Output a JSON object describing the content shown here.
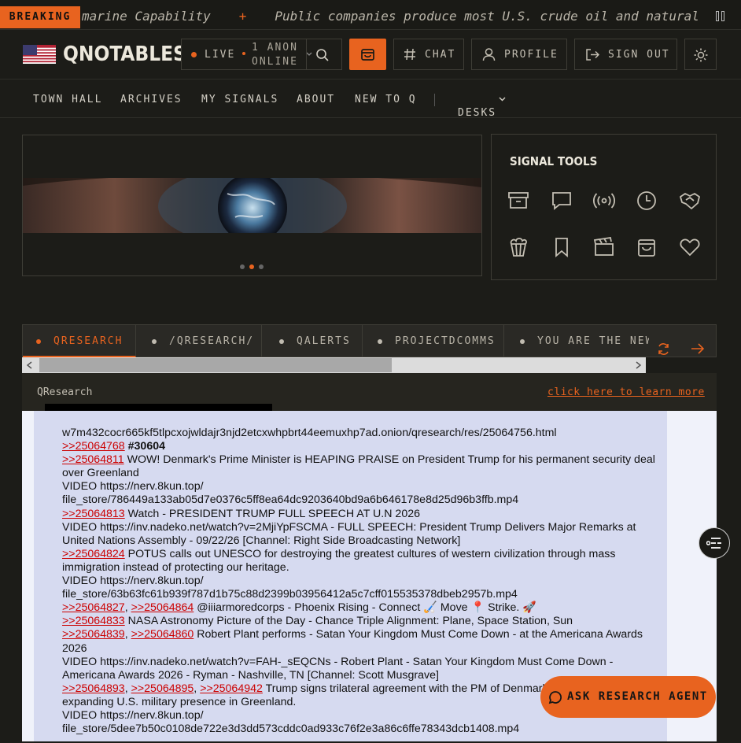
{
  "ticker": {
    "badge": "BREAKING",
    "items": [
      "marine Capability",
      "Public companies produce most U.S. crude oil and natural g"
    ],
    "separator": "+"
  },
  "header": {
    "logo": "QNOTABLES",
    "live_label": "LIVE",
    "online_count": "1 ANON",
    "online_label": "ONLINE",
    "chat_label": "CHAT",
    "profile_label": "PROFILE",
    "signout_label": "SIGN OUT"
  },
  "nav": {
    "items": [
      "TOWN HALL",
      "ARCHIVES",
      "MY SIGNALS",
      "ABOUT",
      "NEW TO Q"
    ],
    "desks_label": "DESKS"
  },
  "tools": {
    "title": "SIGNAL TOOLS",
    "icons": [
      "archive-icon",
      "chat-bubble-icon",
      "broadcast-icon",
      "clock-icon",
      "handshake-icon",
      "popcorn-icon",
      "bookmark-icon",
      "clapperboard-icon",
      "shopping-bag-icon",
      "heart-icon"
    ]
  },
  "tabs": [
    "QRESEARCH",
    "/QRESEARCH/",
    "QALERTS",
    "PROJECTDCOMMS",
    "YOU ARE THE NEW"
  ],
  "frame": {
    "board_name": "QResearch",
    "learn_more": "click here to learn more"
  },
  "post": {
    "url_line": "w7m432cocr665kf5tlpcxojwldajr3njd2etcxwhpbrt44eemuxhp7ad.onion/qresearch/res/25064756.html",
    "l1_ref": ">>25064768",
    "l1_text": "#30604",
    "l2_ref": ">>25064811",
    "l2_text": " WOW! Denmark's Prime Minister is HEAPING PRAISE on President Trump for his permanent security deal over Greenland",
    "l3": "VIDEO https://nerv.8kun.top/",
    "l4": "file_store/786449a133ab05d7e0376c5ff8ea64dc9203640bd9a6b646178e8d25d96b3ffb.mp4",
    "l5_ref": ">>25064813",
    "l5_text": " Watch - PRESIDENT TRUMP FULL SPEECH AT U.N 2026",
    "l6": "VIDEO https://inv.nadeko.net/watch?v=2MjiYpFSCMA - FULL SPEECH: President Trump Delivers Major Remarks at United Nations Assembly - 09/22/26 [Channel: Right Side Broadcasting Network]",
    "l7_ref": ">>25064824",
    "l7_text": " POTUS calls out UNESCO for destroying the greatest cultures of western civilization through mass immigration instead of protecting our heritage.",
    "l8": "VIDEO https://nerv.8kun.top/",
    "l9": "file_store/63b63fc61b939f787d1b75c88d2399b03956412a5c7cff015535378dbeb2957b.mp4",
    "l10_ref_a": ">>25064827",
    "l10_ref_b": ">>25064864",
    "l10_text": " @iiiarmoredcorps - Phoenix Rising - Connect 🏑 Move 📍 Strike. 🚀",
    "l11_ref": ">>25064833",
    "l11_text": " NASA Astronomy Picture of the Day - Chance Triple Alignment: Plane, Space Station, Sun",
    "l12_ref_a": ">>25064839",
    "l12_ref_b": ">>25064860",
    "l12_text": " Robert Plant performs - Satan Your Kingdom Must Come Down - at the Americana Awards 2026",
    "l13": "VIDEO https://inv.nadeko.net/watch?v=FAH-_sEQCNs - Robert Plant - Satan Your Kingdom Must Come Down - Americana Awards 2026 - Ryman - Nashville, TN [Channel: Scott Musgrave]",
    "l14_ref_a": ">>25064893",
    "l14_ref_b": ">>25064895",
    "l14_ref_c": ">>25064942",
    "l14_text": " Trump signs trilateral agreement with the PM of Denmark and PM of Greenland, expanding U.S. military presence in Greenland.",
    "l15": "VIDEO https://nerv.8kun.top/",
    "l16": "file_store/5dee7b50c0108de722e3d3dd573cddc0ad933c76f2e3a86c6ffe78343dcb1408.mp4"
  },
  "agent_label": "ASK RESEARCH AGENT",
  "colors": {
    "accent": "#e8631f",
    "bg": "#1c1c18",
    "link": "#cc0000",
    "post_bg": "#d6daf0"
  }
}
